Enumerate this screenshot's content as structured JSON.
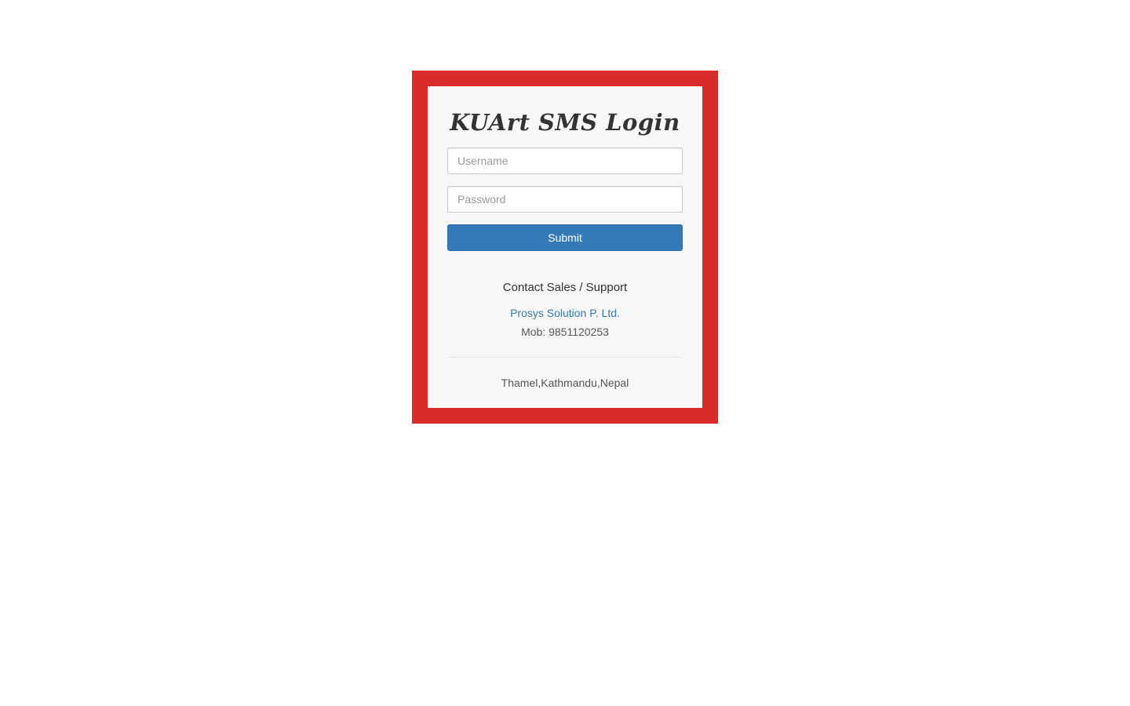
{
  "login": {
    "title": "KUArt SMS Login",
    "username_placeholder": "Username",
    "password_placeholder": "Password",
    "submit_label": "Submit"
  },
  "contact": {
    "heading": "Contact Sales / Support",
    "company": "Prosys Solution P. Ltd.",
    "mobile": "Mob: 9851120253",
    "address": "Thamel,Kathmandu,Nepal"
  },
  "colors": {
    "frame": "#d92b2b",
    "card": "#f7f7f7",
    "primary": "#337ab7"
  }
}
